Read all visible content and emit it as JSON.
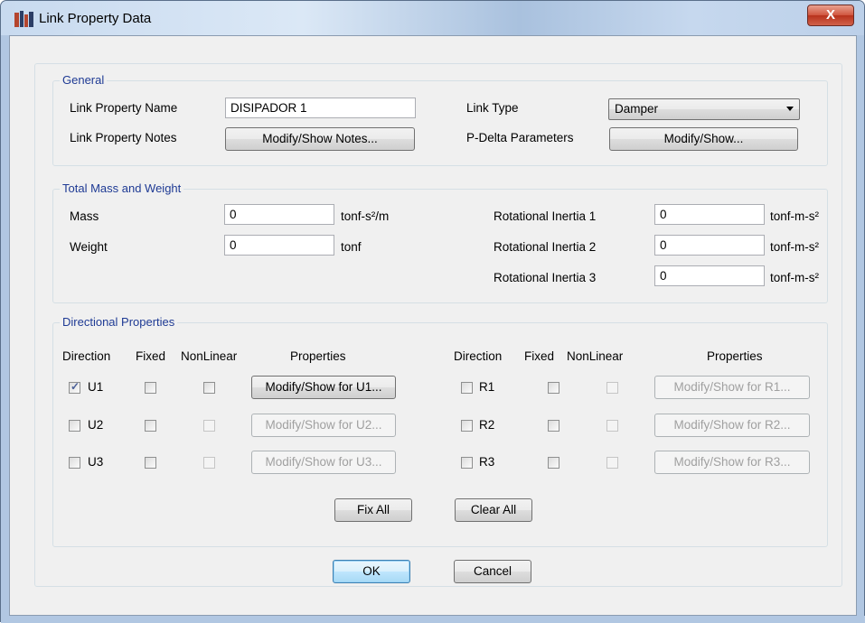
{
  "window": {
    "title": "Link Property Data",
    "close_label": "X"
  },
  "general": {
    "title": "General",
    "name_label": "Link Property Name",
    "name_value": "DISIPADOR 1",
    "notes_label": "Link Property Notes",
    "notes_button": "Modify/Show Notes...",
    "type_label": "Link Type",
    "type_value": "Damper",
    "pdelta_label": "P-Delta Parameters",
    "pdelta_button": "Modify/Show..."
  },
  "mass": {
    "title": "Total Mass and Weight",
    "mass_label": "Mass",
    "mass_value": "0",
    "mass_unit": "tonf-s²/m",
    "weight_label": "Weight",
    "weight_value": "0",
    "weight_unit": "tonf",
    "rot1_label": "Rotational Inertia 1",
    "rot1_value": "0",
    "rot1_unit": "tonf-m-s²",
    "rot2_label": "Rotational Inertia 2",
    "rot2_value": "0",
    "rot2_unit": "tonf-m-s²",
    "rot3_label": "Rotational Inertia 3",
    "rot3_value": "0",
    "rot3_unit": "tonf-m-s²"
  },
  "directional": {
    "title": "Directional Properties",
    "headers": {
      "direction": "Direction",
      "fixed": "Fixed",
      "nonlinear": "NonLinear",
      "properties": "Properties"
    },
    "left": [
      {
        "dir": "U1",
        "checked": true,
        "button": "Modify/Show for U1...",
        "enabled": true
      },
      {
        "dir": "U2",
        "checked": false,
        "button": "Modify/Show for U2...",
        "enabled": false
      },
      {
        "dir": "U3",
        "checked": false,
        "button": "Modify/Show for U3...",
        "enabled": false
      }
    ],
    "right": [
      {
        "dir": "R1",
        "checked": false,
        "button": "Modify/Show for R1...",
        "enabled": false
      },
      {
        "dir": "R2",
        "checked": false,
        "button": "Modify/Show for R2...",
        "enabled": false
      },
      {
        "dir": "R3",
        "checked": false,
        "button": "Modify/Show for R3...",
        "enabled": false
      }
    ],
    "fix_all": "Fix All",
    "clear_all": "Clear All"
  },
  "footer": {
    "ok": "OK",
    "cancel": "Cancel"
  }
}
